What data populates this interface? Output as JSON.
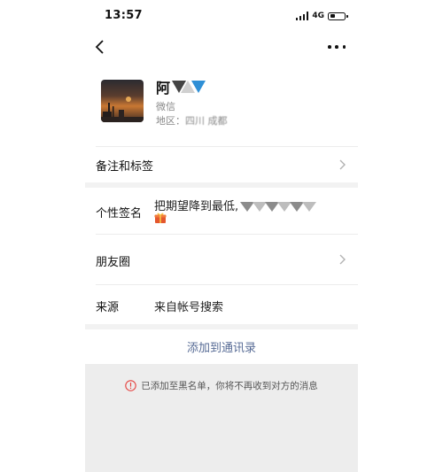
{
  "status_bar": {
    "time": "13:57",
    "network": "4G",
    "battery_level": 0.4
  },
  "nav": {
    "back_icon": "chevron-left-icon",
    "more_icon": "more-dots-icon"
  },
  "profile": {
    "name": "阿",
    "wechat_label": "微信",
    "region_label": "地区：",
    "region_value": "四川 成都"
  },
  "rows": {
    "remarks": {
      "label": "备注和标签"
    },
    "signature": {
      "label": "个性签名",
      "value": "把期望降到最低,"
    },
    "moments": {
      "label": "朋友圈"
    },
    "source": {
      "label": "来源",
      "value": "来自帐号搜索"
    }
  },
  "actions": {
    "add_contact": "添加到通讯录"
  },
  "notice": {
    "text": "已添加至黑名单，你将不再收到对方的消息"
  },
  "colors": {
    "link": "#576b95",
    "warning": "#e64340",
    "background_grey": "#ededed"
  }
}
